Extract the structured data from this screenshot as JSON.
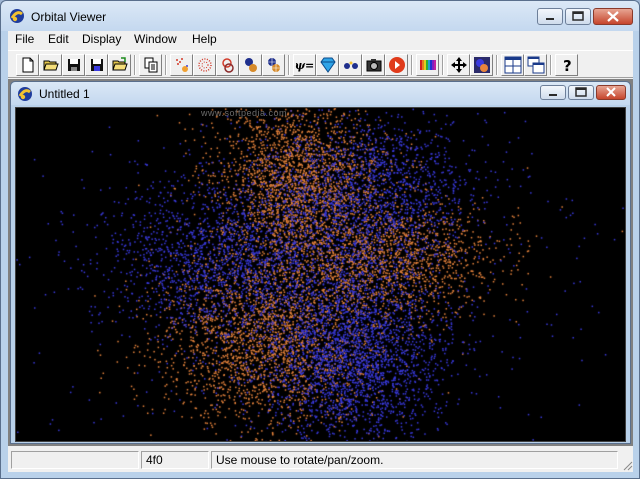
{
  "window": {
    "title": "Orbital Viewer"
  },
  "menu": [
    "File",
    "Edit",
    "Display",
    "Window",
    "Help"
  ],
  "toolbar": {
    "buttons": [
      {
        "name": "new-file-icon"
      },
      {
        "name": "open-folder-icon"
      },
      {
        "name": "save-icon"
      },
      {
        "name": "save-as-icon"
      },
      {
        "name": "open-recent-icon"
      },
      {
        "name": "copy-icon"
      },
      {
        "name": "orbital-points-icon"
      },
      {
        "name": "orbital-cloud-icon"
      },
      {
        "name": "orbital-stereo-icon"
      },
      {
        "name": "orbital-surface-icon"
      },
      {
        "name": "orbital-polygon-icon"
      },
      {
        "name": "wavefunction-icon"
      },
      {
        "name": "diamond-icon"
      },
      {
        "name": "atoms-icon"
      },
      {
        "name": "camera-icon"
      },
      {
        "name": "play-icon"
      },
      {
        "name": "color-palette-icon"
      },
      {
        "name": "move-arrows-icon"
      },
      {
        "name": "render-icon"
      },
      {
        "name": "tile-windows-icon"
      },
      {
        "name": "cascade-windows-icon"
      },
      {
        "name": "help-icon"
      }
    ],
    "wavefunction_label": "ψ="
  },
  "child": {
    "title": "Untitled 1",
    "watermark": "www.softpedia.com"
  },
  "status": {
    "pane1": "",
    "pane2": "4f0",
    "pane3": "Use mouse to rotate/pan/zoom."
  },
  "colors": {
    "positive_lobe": "#e8843c",
    "negative_lobe": "#3a3adf",
    "background": "#000000"
  }
}
